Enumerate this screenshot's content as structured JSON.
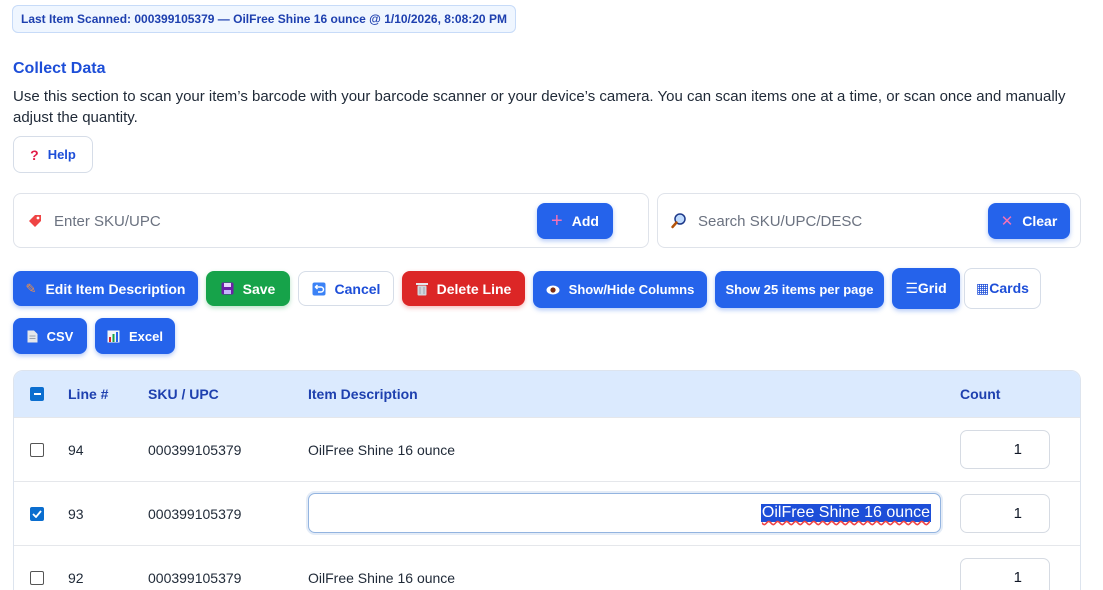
{
  "last_scanned": "Last Item Scanned: 000399105379 — OilFree Shine 16 ounce @ 1/10/2026, 8:08:20 PM",
  "collect": {
    "title": "Collect Data",
    "description": "Use this section to scan your item’s barcode with your barcode scanner or your device’s camera. You can scan items one at a time, or scan once and manually adjust the quantity.",
    "help_label": "Help"
  },
  "sku_input": {
    "placeholder": "Enter SKU/UPC",
    "value": "",
    "add_label": "Add"
  },
  "search_input": {
    "placeholder": "Search SKU/UPC/DESC",
    "value": "",
    "clear_label": "Clear"
  },
  "toolbar": {
    "edit_label": "Edit Item Description",
    "save_label": "Save",
    "cancel_label": "Cancel",
    "delete_label": "Delete Line",
    "columns_label": "Show/Hide Columns",
    "page_size_label": "Show 25 items per page",
    "grid_label": "☰Grid",
    "cards_label": "▦Cards",
    "csv_label": "CSV",
    "excel_label": "Excel"
  },
  "table": {
    "columns": [
      "Line #",
      "SKU / UPC",
      "Item Description",
      "Count"
    ],
    "rows": [
      {
        "line": "94",
        "sku": "000399105379",
        "desc": "OilFree Shine 16 ounce",
        "count": "1",
        "checked": false,
        "editing": false
      },
      {
        "line": "93",
        "sku": "000399105379",
        "desc": "OilFree Shine 16 ounce",
        "count": "1",
        "checked": true,
        "editing": true
      },
      {
        "line": "92",
        "sku": "000399105379",
        "desc": "OilFree Shine 16 ounce",
        "count": "1",
        "checked": false,
        "editing": false
      }
    ]
  },
  "colors": {
    "primary": "#2563eb",
    "success": "#16a34a",
    "danger": "#dc2626",
    "header_bg": "#dbeafe",
    "title": "#1d4ed8"
  }
}
